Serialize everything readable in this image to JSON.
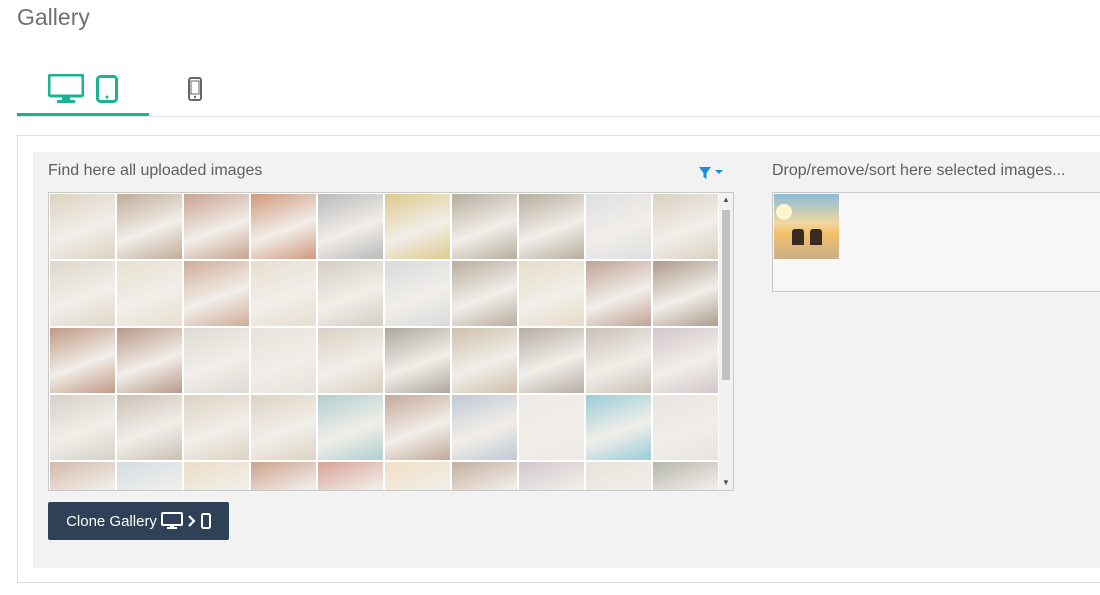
{
  "page": {
    "title": "Gallery"
  },
  "device_tabs": [
    {
      "name": "desktop-tablet",
      "icons": [
        "desktop-icon",
        "tablet-icon"
      ],
      "active": true
    },
    {
      "name": "mobile",
      "icons": [
        "mobile-icon"
      ],
      "active": false
    }
  ],
  "uploaded": {
    "title": "Find here all uploaded images",
    "filter_icon": "filter-icon"
  },
  "selected": {
    "title": "Drop/remove/sort here selected images..."
  },
  "clone_button": {
    "label": "Clone Gallery"
  },
  "colors": {
    "accent": "#1bb394",
    "filter": "#1a8fd6",
    "button_bg": "#2f4156"
  }
}
